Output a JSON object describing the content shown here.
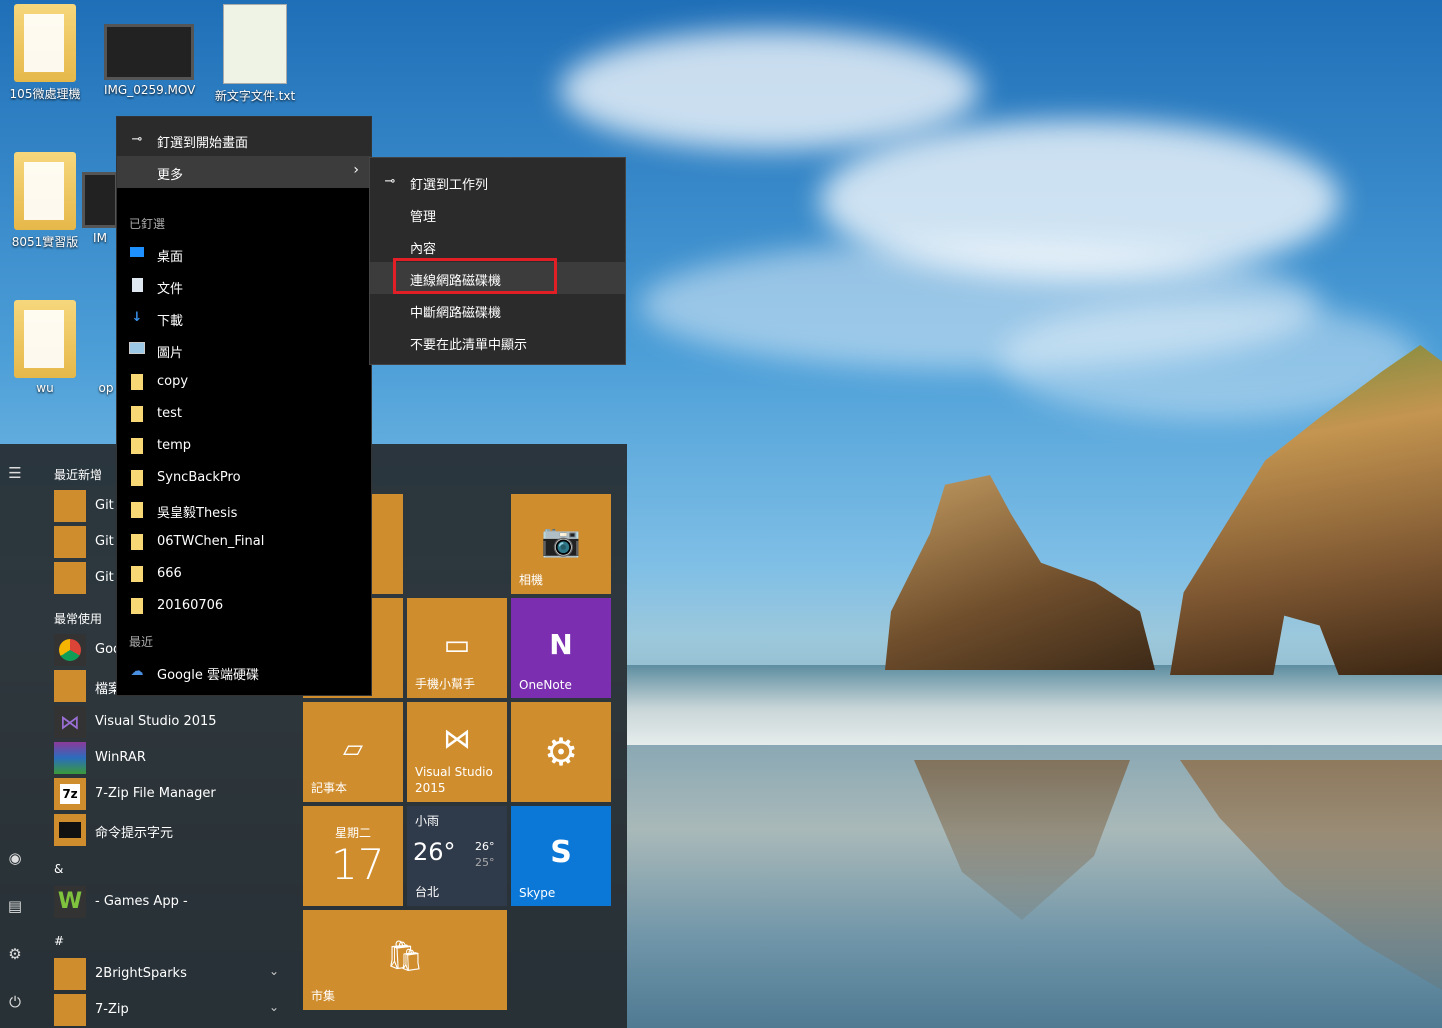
{
  "desktop": {
    "icons": [
      {
        "label": "105微處理機",
        "icon": "folder-icon"
      },
      {
        "label": "IMG_0259.MOV",
        "icon": "video-file-icon"
      },
      {
        "label": "新文字文件.txt",
        "icon": "notepad-plus-icon"
      },
      {
        "label": "8051實習版",
        "icon": "folder-icon"
      },
      {
        "label": "IM",
        "icon": "video-file-icon"
      },
      {
        "label": "wu",
        "icon": "pdf-folder-icon"
      },
      {
        "label": "op",
        "icon": "file-icon"
      }
    ]
  },
  "context_menu": {
    "pin_start": "釘選到開始畫面",
    "more": "更多",
    "pinned_header": "已釘選",
    "pinned": [
      {
        "label": "桌面",
        "icon": "desktop-icon"
      },
      {
        "label": "文件",
        "icon": "document-icon"
      },
      {
        "label": "下載",
        "icon": "download-icon"
      },
      {
        "label": "圖片",
        "icon": "picture-icon"
      },
      {
        "label": "copy",
        "icon": "folder-icon"
      },
      {
        "label": "test",
        "icon": "folder-icon"
      },
      {
        "label": "temp",
        "icon": "folder-icon"
      },
      {
        "label": "SyncBackPro",
        "icon": "folder-icon"
      },
      {
        "label": "吳皇毅Thesis",
        "icon": "folder-icon"
      },
      {
        "label": "06TWChen_Final",
        "icon": "folder-icon"
      },
      {
        "label": "666",
        "icon": "folder-icon"
      },
      {
        "label": "20160706",
        "icon": "folder-icon"
      }
    ],
    "recent_header": "最近",
    "recent": [
      {
        "label": "Google 雲端硬碟",
        "icon": "google-drive-icon"
      }
    ]
  },
  "submenu": {
    "items": [
      "釘選到工作列",
      "管理",
      "內容",
      "連線網路磁碟機",
      "中斷網路磁碟機",
      "不要在此清單中顯示"
    ],
    "highlighted": "連線網路磁碟機",
    "highlight_color": "#e21f26"
  },
  "start_menu": {
    "recent_header": "最近新增",
    "recent_apps": [
      "Git",
      "Git",
      "Git"
    ],
    "frequent_header": "最常使用",
    "frequent_apps": [
      "Goo",
      "檔案",
      "Visual Studio 2015",
      "WinRAR",
      "7-Zip File Manager",
      "命令提示字元"
    ],
    "groups": [
      {
        "header": "&",
        "apps": [
          "- Games App -"
        ]
      },
      {
        "header": "#",
        "apps": [
          "2BrightSparks",
          "7-Zip"
        ]
      }
    ],
    "tiles": {
      "camera": "相機",
      "phone": "手機小幫手",
      "onenote": "OneNote",
      "notepad": "記事本",
      "vs": "Visual Studio 2015",
      "settings": "",
      "calendar_day": "星期二",
      "calendar_date": "17",
      "weather_cond": "小雨",
      "weather_temp": "26°",
      "weather_hi": "26°",
      "weather_lo": "25°",
      "weather_city": "台北",
      "skype": "Skype",
      "store": "市集"
    },
    "colors": {
      "tile": "#d08d2d",
      "onenote": "#7b2fb0",
      "skype": "#0b78d7",
      "weather": "#2f3a4a"
    }
  }
}
